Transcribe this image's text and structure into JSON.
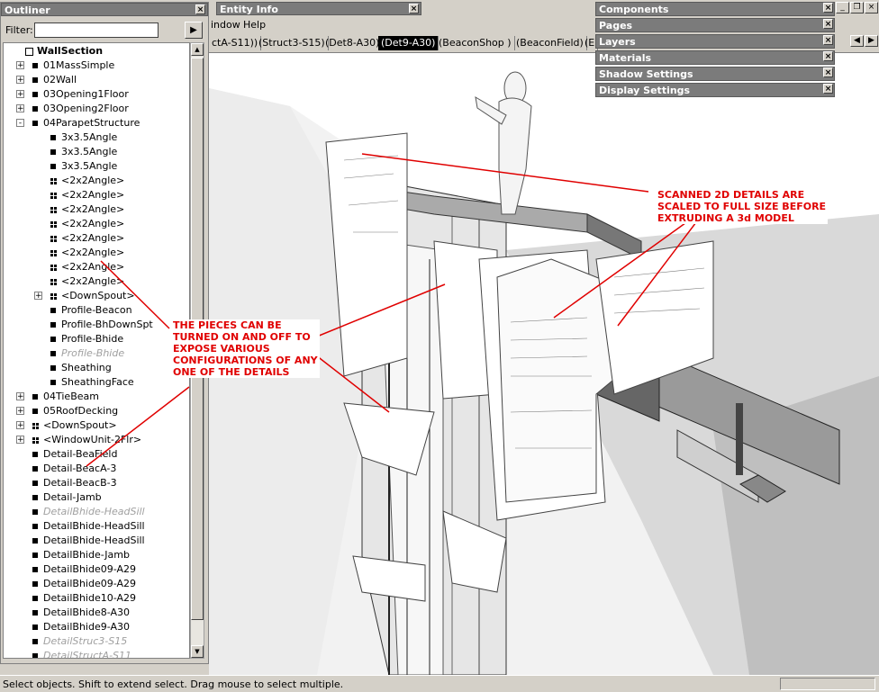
{
  "entity_info": {
    "title": "Entity Info"
  },
  "menubar": {
    "items": [
      "indow",
      "Help"
    ]
  },
  "scenes": {
    "tabs": [
      {
        "label": "ctA-S11))",
        "active": false
      },
      {
        "label": "(Struct3-S15)",
        "active": false
      },
      {
        "label": "(Det8-A30)",
        "active": false
      },
      {
        "label": "(Det9-A30)",
        "active": true
      },
      {
        "label": "(BeaconShop )",
        "active": false
      },
      {
        "label": "(BeaconField)",
        "active": false
      },
      {
        "label": "(E",
        "active": false
      }
    ]
  },
  "outliner": {
    "title": "Outliner",
    "filter_label": "Filter:",
    "filter_value": "",
    "items": [
      {
        "label": "WallSection",
        "indent": 0,
        "icon": "house-icon",
        "expander": "",
        "style": "root"
      },
      {
        "label": "01MassSimple",
        "indent": 1,
        "icon": "square",
        "expander": "+",
        "style": ""
      },
      {
        "label": "02Wall",
        "indent": 1,
        "icon": "square",
        "expander": "+",
        "style": ""
      },
      {
        "label": "03Opening1Floor",
        "indent": 1,
        "icon": "square",
        "expander": "+",
        "style": ""
      },
      {
        "label": "03Opening2Floor",
        "indent": 1,
        "icon": "square",
        "expander": "+",
        "style": ""
      },
      {
        "label": "04ParapetStructure",
        "indent": 1,
        "icon": "square",
        "expander": "-",
        "style": ""
      },
      {
        "label": "3x3.5Angle",
        "indent": 2,
        "icon": "square",
        "expander": "",
        "style": ""
      },
      {
        "label": "3x3.5Angle",
        "indent": 2,
        "icon": "square",
        "expander": "",
        "style": ""
      },
      {
        "label": "3x3.5Angle",
        "indent": 2,
        "icon": "square",
        "expander": "",
        "style": ""
      },
      {
        "label": "<2x2Angle>",
        "indent": 2,
        "icon": "grid",
        "expander": "",
        "style": ""
      },
      {
        "label": "<2x2Angle>",
        "indent": 2,
        "icon": "grid",
        "expander": "",
        "style": ""
      },
      {
        "label": "<2x2Angle>",
        "indent": 2,
        "icon": "grid",
        "expander": "",
        "style": ""
      },
      {
        "label": "<2x2Angle>",
        "indent": 2,
        "icon": "grid",
        "expander": "",
        "style": ""
      },
      {
        "label": "<2x2Angle>",
        "indent": 2,
        "icon": "grid",
        "expander": "",
        "style": ""
      },
      {
        "label": "<2x2Angle>",
        "indent": 2,
        "icon": "grid",
        "expander": "",
        "style": ""
      },
      {
        "label": "<2x2Angle>",
        "indent": 2,
        "icon": "grid",
        "expander": "",
        "style": ""
      },
      {
        "label": "<2x2Angle>",
        "indent": 2,
        "icon": "grid",
        "expander": "",
        "style": ""
      },
      {
        "label": "<DownSpout>",
        "indent": 2,
        "icon": "grid",
        "expander": "+",
        "style": ""
      },
      {
        "label": "Profile-Beacon",
        "indent": 2,
        "icon": "square",
        "expander": "",
        "style": ""
      },
      {
        "label": "Profile-BhDownSpt",
        "indent": 2,
        "icon": "square",
        "expander": "",
        "style": ""
      },
      {
        "label": "Profile-Bhide",
        "indent": 2,
        "icon": "square",
        "expander": "",
        "style": ""
      },
      {
        "label": "Profile-Bhide",
        "indent": 2,
        "icon": "square",
        "expander": "",
        "style": "hidden"
      },
      {
        "label": "Sheathing",
        "indent": 2,
        "icon": "square",
        "expander": "",
        "style": ""
      },
      {
        "label": "SheathingFace",
        "indent": 2,
        "icon": "square",
        "expander": "",
        "style": ""
      },
      {
        "label": "04TieBeam",
        "indent": 1,
        "icon": "square",
        "expander": "+",
        "style": ""
      },
      {
        "label": "05RoofDecking",
        "indent": 1,
        "icon": "square",
        "expander": "+",
        "style": ""
      },
      {
        "label": "<DownSpout>",
        "indent": 1,
        "icon": "grid",
        "expander": "+",
        "style": ""
      },
      {
        "label": "<WindowUnit-2Flr>",
        "indent": 1,
        "icon": "grid",
        "expander": "+",
        "style": ""
      },
      {
        "label": "Detail-BeaField",
        "indent": 1,
        "icon": "square",
        "expander": "",
        "style": ""
      },
      {
        "label": "Detail-BeacA-3",
        "indent": 1,
        "icon": "square",
        "expander": "",
        "style": ""
      },
      {
        "label": "Detail-BeacB-3",
        "indent": 1,
        "icon": "square",
        "expander": "",
        "style": ""
      },
      {
        "label": "Detail-Jamb",
        "indent": 1,
        "icon": "square",
        "expander": "",
        "style": ""
      },
      {
        "label": "DetailBhide-HeadSill",
        "indent": 1,
        "icon": "square",
        "expander": "",
        "style": "hidden"
      },
      {
        "label": "DetailBhide-HeadSill",
        "indent": 1,
        "icon": "square",
        "expander": "",
        "style": ""
      },
      {
        "label": "DetailBhide-HeadSill",
        "indent": 1,
        "icon": "square",
        "expander": "",
        "style": ""
      },
      {
        "label": "DetailBhide-Jamb",
        "indent": 1,
        "icon": "square",
        "expander": "",
        "style": ""
      },
      {
        "label": "DetailBhide09-A29",
        "indent": 1,
        "icon": "square",
        "expander": "",
        "style": ""
      },
      {
        "label": "DetailBhide09-A29",
        "indent": 1,
        "icon": "square",
        "expander": "",
        "style": ""
      },
      {
        "label": "DetailBhide10-A29",
        "indent": 1,
        "icon": "square",
        "expander": "",
        "style": ""
      },
      {
        "label": "DetailBhide8-A30",
        "indent": 1,
        "icon": "square",
        "expander": "",
        "style": ""
      },
      {
        "label": "DetailBhide9-A30",
        "indent": 1,
        "icon": "square",
        "expander": "",
        "style": ""
      },
      {
        "label": "DetailStruc3-S15",
        "indent": 1,
        "icon": "square",
        "expander": "",
        "style": "hidden"
      },
      {
        "label": "DetailStructA-S11",
        "indent": 1,
        "icon": "square",
        "expander": "",
        "style": "hidden"
      }
    ]
  },
  "panels": [
    {
      "label": "Components"
    },
    {
      "label": "Pages"
    },
    {
      "label": "Layers"
    },
    {
      "label": "Materials"
    },
    {
      "label": "Shadow Settings"
    },
    {
      "label": "Display Settings"
    }
  ],
  "annotations": {
    "scanned": "SCANNED 2D DETAILS ARE\nSCALED TO FULL SIZE BEFORE\nEXTRUDING A 3d MODEL",
    "pieces": "THE PIECES CAN BE\nTURNED ON AND OFF TO\nEXPOSE VARIOUS\nCONFIGURATIONS OF ANY\nONE OF THE DETAILS"
  },
  "statusbar": {
    "text": "Select objects. Shift to extend select. Drag mouse to select multiple."
  },
  "colors": {
    "annotation": "#e00000",
    "titlebar": "#7b7b7b",
    "chrome": "#d4d0c8"
  }
}
